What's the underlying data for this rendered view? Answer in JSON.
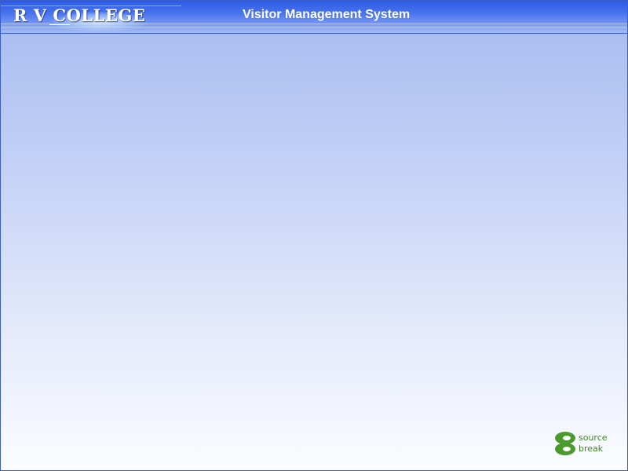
{
  "header": {
    "logo_text": "R V COLLEGE",
    "title": "Visitor Management System"
  },
  "footer_logo": {
    "line1": "source",
    "line2": "break",
    "icon": "sourcebreak-logo-icon",
    "color": "#3f8a23"
  },
  "colors": {
    "header_blue": "#2d5ae6",
    "border": "#3a5fcd",
    "background_top": "#a4b9ef",
    "background_bottom": "#fbfcff"
  }
}
